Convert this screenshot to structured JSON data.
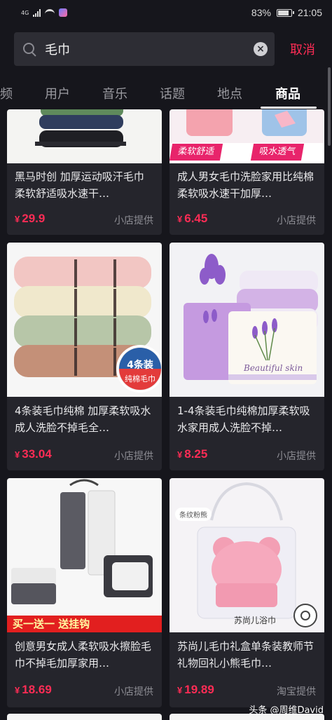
{
  "status": {
    "network": "4G",
    "battery": "83%",
    "time": "21:05"
  },
  "search": {
    "query": "毛巾",
    "cancel_label": "取消"
  },
  "tabs": [
    {
      "label": "频"
    },
    {
      "label": "用户"
    },
    {
      "label": "音乐"
    },
    {
      "label": "话题"
    },
    {
      "label": "地点"
    },
    {
      "label": "商品"
    }
  ],
  "products": [
    {
      "title": "黑马时创 加厚运动吸汗毛巾 柔软舒适吸水速干…",
      "currency": "¥",
      "price": "29.9",
      "provider": "小店提供",
      "image_label": ""
    },
    {
      "title": "成人男女毛巾洗脸家用比纯棉柔软吸水速干加厚…",
      "currency": "¥",
      "price": "6.45",
      "provider": "小店提供",
      "image_label": "柔软舒适  吸水透气"
    },
    {
      "title": "4条装毛巾纯棉 加厚柔软吸水成人洗脸不掉毛全…",
      "currency": "¥",
      "price": "33.04",
      "provider": "小店提供",
      "image_label": "4条装",
      "image_sublabel": "纯棉毛巾"
    },
    {
      "title": "1-4条装毛巾纯棉加厚柔软吸水家用成人洗脸不掉…",
      "currency": "¥",
      "price": "8.25",
      "provider": "小店提供",
      "image_label": "Beautiful skin"
    },
    {
      "title": "创意男女成人柔软吸水擦脸毛巾不掉毛加厚家用…",
      "currency": "¥",
      "price": "18.69",
      "provider": "小店提供",
      "image_label": "买一送一  送挂钩"
    },
    {
      "title": "苏尚儿毛巾礼盒单条装教师节礼物回礼小熊毛巾…",
      "currency": "¥",
      "price": "19.89",
      "provider": "淘宝提供",
      "image_label": "苏尚儿浴巾",
      "image_tag": "条纹粉熊"
    }
  ],
  "watermark": {
    "text": "头条 @周维David"
  }
}
